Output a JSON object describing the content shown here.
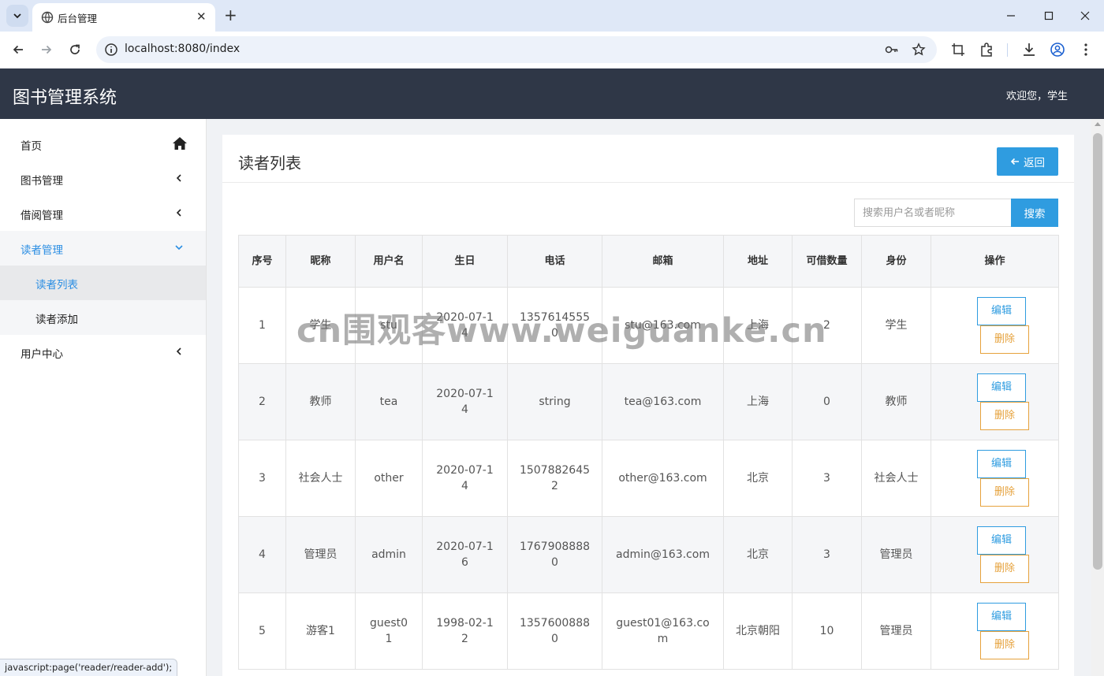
{
  "browser": {
    "tab_title": "后台管理",
    "tab_close": "✕",
    "new_tab": "+",
    "url": "localhost:8080/index",
    "status_url": "javascript:page('reader/reader-add');"
  },
  "header": {
    "app_title": "图书管理系统",
    "welcome": "欢迎您，学生"
  },
  "sidebar": {
    "items": [
      {
        "label": "首页",
        "icon": "home-icon"
      },
      {
        "label": "图书管理",
        "icon": "chevron-left-icon"
      },
      {
        "label": "借阅管理",
        "icon": "chevron-left-icon"
      },
      {
        "label": "读者管理",
        "icon": "chevron-down-icon",
        "active": true
      },
      {
        "label": "用户中心",
        "icon": "chevron-left-icon"
      }
    ],
    "sub_items": [
      {
        "label": "读者列表",
        "current": true
      },
      {
        "label": "读者添加"
      }
    ]
  },
  "page": {
    "title": "读者列表",
    "back_label": "返回",
    "search_placeholder": "搜索用户名或者昵称",
    "search_label": "搜索"
  },
  "table": {
    "headers": [
      "序号",
      "昵称",
      "用户名",
      "生日",
      "电话",
      "邮箱",
      "地址",
      "可借数量",
      "身份",
      "操作"
    ],
    "rows": [
      {
        "no": "1",
        "nickname": "学生",
        "username": "stu",
        "birthday": "2020-07-14",
        "phone": "13576145550",
        "email": "stu@163.com",
        "address": "上海",
        "quota": "2",
        "role": "学生"
      },
      {
        "no": "2",
        "nickname": "教师",
        "username": "tea",
        "birthday": "2020-07-14",
        "phone": "string",
        "email": "tea@163.com",
        "address": "上海",
        "quota": "0",
        "role": "教师"
      },
      {
        "no": "3",
        "nickname": "社会人士",
        "username": "other",
        "birthday": "2020-07-14",
        "phone": "15078826452",
        "email": "other@163.com",
        "address": "北京",
        "quota": "3",
        "role": "社会人士"
      },
      {
        "no": "4",
        "nickname": "管理员",
        "username": "admin",
        "birthday": "2020-07-16",
        "phone": "17679088880",
        "email": "admin@163.com",
        "address": "北京",
        "quota": "3",
        "role": "管理员"
      },
      {
        "no": "5",
        "nickname": "游客1",
        "username": "guest01",
        "birthday": "1998-02-12",
        "phone": "13576008880",
        "email": "guest01@163.com",
        "address": "北京朝阳",
        "quota": "10",
        "role": "管理员"
      }
    ],
    "edit_label": "编辑",
    "delete_label": "删除"
  },
  "watermark": "cn围观客www.weiguanke.cn",
  "colors": {
    "header_bg": "#2f3747",
    "primary": "#2f9ce0",
    "warning": "#e6a23c",
    "active_text": "#2b8ee3"
  }
}
